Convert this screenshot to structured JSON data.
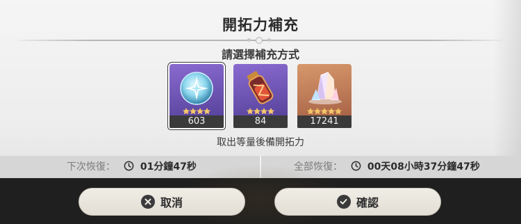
{
  "dialog": {
    "title": "開拓力補充",
    "subtitle": "請選擇補充方式",
    "items": [
      {
        "count": "603",
        "stars": 4,
        "rarity": "purple",
        "icon": "fuel-orb-icon",
        "selected": true
      },
      {
        "count": "84",
        "stars": 4,
        "rarity": "purple",
        "icon": "fuel-vial-icon",
        "selected": false
      },
      {
        "count": "17241",
        "stars": 5,
        "rarity": "orange",
        "icon": "crystal-icon",
        "selected": false
      }
    ],
    "hint": "取出等量後備開拓力"
  },
  "recovery": {
    "next_label": "下次恢復：",
    "next_value": "01分鐘47秒",
    "full_label": "全部恢復：",
    "full_value": "00天08小時37分鐘47秒"
  },
  "footer": {
    "cancel_label": "取消",
    "confirm_label": "確認"
  },
  "colors": {
    "purple_rarity": "#6a52b0",
    "orange_rarity": "#c07a52",
    "star": "#f4c76a",
    "button_bg": "#ebe7de",
    "footer_bg": "#1f1f1f"
  }
}
